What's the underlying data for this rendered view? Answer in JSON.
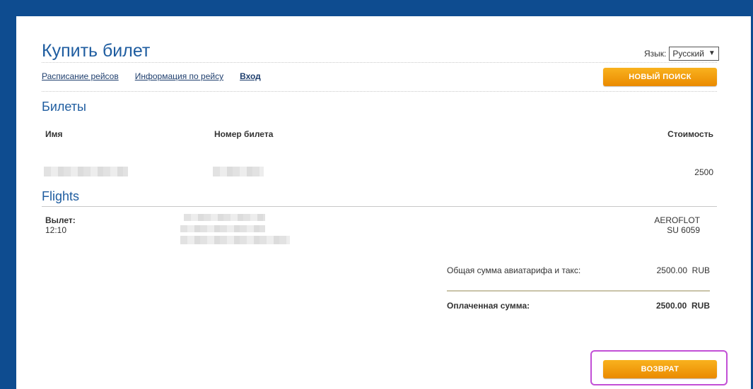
{
  "header": {
    "title": "Купить билет",
    "language_label": "Язык:",
    "language_value": "Русский"
  },
  "nav": {
    "items": [
      "Расписание рейсов",
      "Информация по рейсу",
      "Вход"
    ]
  },
  "buttons": {
    "new_search": "НОВЫЙ ПОИСК",
    "refund": "ВОЗВРАТ"
  },
  "tickets": {
    "section_title": "Билеты",
    "columns": [
      "Имя",
      "Номер билета",
      "Стоимость"
    ],
    "rows": [
      {
        "name": "",
        "ticket_number": "",
        "price": "2500"
      }
    ]
  },
  "flights": {
    "section_title": "Flights",
    "departure_label": "Вылет:",
    "departure_time": "12:10",
    "airline": "AEROFLOT",
    "flight_number": "SU 6059"
  },
  "summary": {
    "total_label": "Общая сумма авиатарифа и такс:",
    "total_value": "2500.00  RUB",
    "paid_label": "Оплаченная сумма:",
    "paid_value": "2500.00  RUB"
  },
  "colors": {
    "background": "#0e4c90",
    "accent": "#1f5da0",
    "button": "#f29e0f",
    "highlight": "#c24fd6"
  }
}
